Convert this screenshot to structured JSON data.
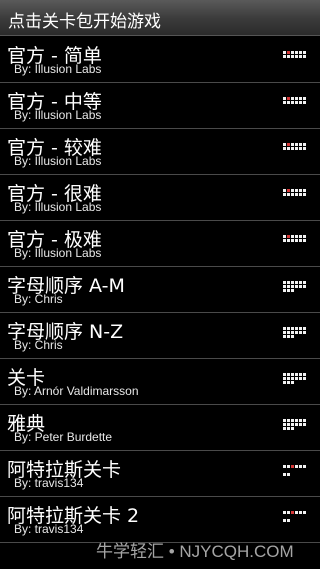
{
  "header": {
    "title": "点击关卡包开始游戏"
  },
  "packs": [
    {
      "name": "官方 - 简单",
      "author": "By: Illusion Labs",
      "progress": "partial"
    },
    {
      "name": "官方 - 中等",
      "author": "By: Illusion Labs",
      "progress": "partial"
    },
    {
      "name": "官方 - 较难",
      "author": "By: Illusion Labs",
      "progress": "partial"
    },
    {
      "name": "官方 - 很难",
      "author": "By: Illusion Labs",
      "progress": "partial"
    },
    {
      "name": "官方 - 极难",
      "author": "By: Illusion Labs",
      "progress": "partial"
    },
    {
      "name": "字母顺序 A-M",
      "author": "By: Chris",
      "progress": "full"
    },
    {
      "name": "字母顺序 N-Z",
      "author": "By: Chris",
      "progress": "full"
    },
    {
      "name": "关卡",
      "author": "By: Arnór Valdimarsson",
      "progress": "full"
    },
    {
      "name": "雅典",
      "author": "By: Peter Burdette",
      "progress": "full"
    },
    {
      "name": "阿特拉斯关卡",
      "author": "By: travis134",
      "progress": "small"
    },
    {
      "name": "阿特拉斯关卡 2",
      "author": "By: travis134",
      "progress": "small"
    }
  ],
  "icons": {
    "level_grid": "level-grid-icon"
  },
  "colors": {
    "grid_active": "#f2f2f2",
    "grid_highlight": "#d83838",
    "divider": "#4a4a4a"
  },
  "watermark": "牛学轻汇 • NJYCQH.COM"
}
